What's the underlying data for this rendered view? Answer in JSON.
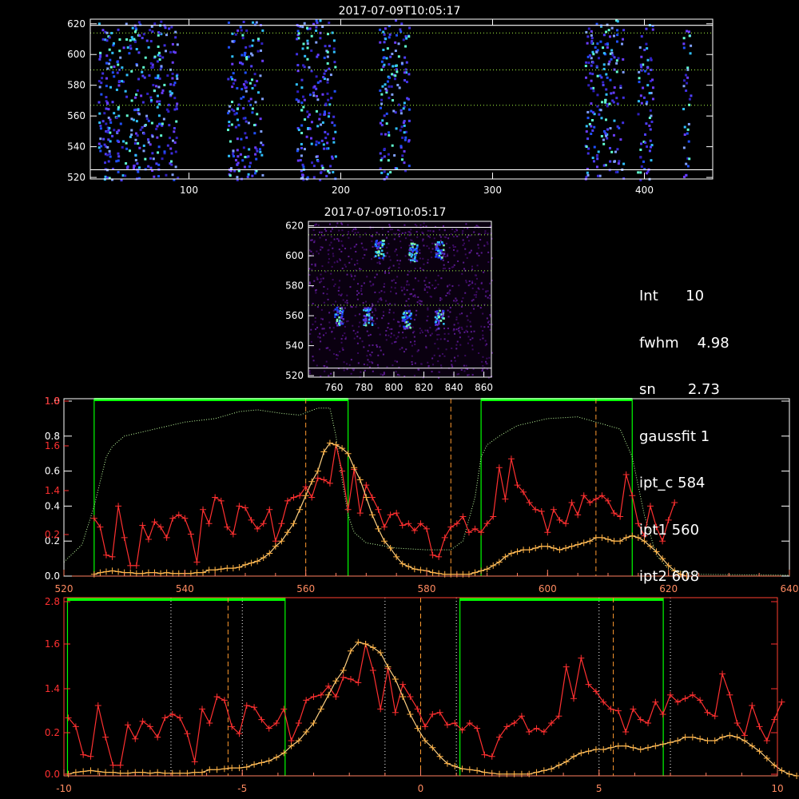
{
  "titles": {
    "top": "2017-07-09T10:05:17",
    "middle": "2017-07-09T10:05:17"
  },
  "info": [
    {
      "label": "Int",
      "value": "10"
    },
    {
      "label": "fwhm",
      "value": "4.98"
    },
    {
      "label": "sn",
      "value": "2.73"
    },
    {
      "label": "gaussfit",
      "value": "1"
    },
    {
      "label": "ipt_c",
      "value": "584"
    },
    {
      "label": "ipt1",
      "value": "560"
    },
    {
      "label": "ipt2",
      "value": "608"
    }
  ],
  "colors": {
    "red": "#ff3030",
    "orange": "#ffb040",
    "green": "#00ff00",
    "dash": "#ff9a30",
    "white": "#ffffff"
  },
  "chart_data": [
    {
      "type": "heatmap",
      "title": "2017-07-09T10:05:17",
      "xlim": [
        35,
        445
      ],
      "ylim": [
        519,
        623
      ],
      "xticks": [
        100,
        200,
        300,
        400
      ],
      "yticks": [
        520,
        540,
        560,
        580,
        600,
        620
      ],
      "column_bands": [
        [
          40,
          92
        ],
        [
          125,
          148
        ],
        [
          170,
          196
        ],
        [
          225,
          245
        ],
        [
          360,
          386
        ],
        [
          395,
          405
        ],
        [
          425,
          430
        ]
      ],
      "hlines_solid": [
        525,
        619
      ],
      "hlines_dotted": [
        567,
        590,
        614
      ]
    },
    {
      "type": "heatmap",
      "title": "2017-07-09T10:05:17",
      "xlim": [
        743,
        865
      ],
      "ylim": [
        519,
        623
      ],
      "xticks": [
        760,
        780,
        800,
        820,
        840,
        860
      ],
      "yticks": [
        520,
        540,
        560,
        580,
        600,
        620
      ],
      "blobs": [
        [
          763,
          560
        ],
        [
          782,
          560
        ],
        [
          808,
          558
        ],
        [
          830,
          558
        ],
        [
          830,
          604
        ],
        [
          790,
          605
        ],
        [
          812,
          603
        ]
      ],
      "hlines_solid": [
        525,
        619
      ],
      "hlines_dotted": [
        567,
        590,
        614
      ]
    },
    {
      "type": "line",
      "xlim": [
        520,
        640
      ],
      "xticks": [
        520,
        540,
        560,
        580,
        600,
        620,
        640
      ],
      "left_axis_white": {
        "ylim": [
          0,
          1.0
        ],
        "ticks": [
          "0.0",
          "0.2",
          "0.4",
          "0.6",
          "0.8",
          "1.0"
        ]
      },
      "left_axis_red": {
        "ticks": [
          "0.2",
          "1.4",
          "1.6",
          "1.8"
        ]
      },
      "red_x_start": 525,
      "red_x_step": 1,
      "red_values": [
        0.33,
        0.28,
        0.12,
        0.11,
        0.4,
        0.22,
        0.06,
        0.06,
        0.29,
        0.21,
        0.31,
        0.28,
        0.22,
        0.33,
        0.35,
        0.33,
        0.24,
        0.08,
        0.38,
        0.3,
        0.45,
        0.43,
        0.28,
        0.24,
        0.4,
        0.39,
        0.32,
        0.27,
        0.3,
        0.38,
        0.2,
        0.3,
        0.43,
        0.45,
        0.46,
        0.51,
        0.45,
        0.56,
        0.55,
        0.53,
        0.75,
        0.6,
        0.38,
        0.61,
        0.36,
        0.52,
        0.45,
        0.38,
        0.28,
        0.35,
        0.36,
        0.29,
        0.3,
        0.26,
        0.3,
        0.27,
        0.12,
        0.11,
        0.22,
        0.28,
        0.3,
        0.34,
        0.25,
        0.27,
        0.25,
        0.3,
        0.34,
        0.62,
        0.44,
        0.67,
        0.52,
        0.48,
        0.42,
        0.38,
        0.37,
        0.25,
        0.38,
        0.32,
        0.3,
        0.42,
        0.35,
        0.46,
        0.42,
        0.44,
        0.46,
        0.43,
        0.36,
        0.34,
        0.58,
        0.46,
        0.3,
        0.23,
        0.4,
        0.28,
        0.2,
        0.32,
        0.42
      ],
      "orange_x_start": 525,
      "orange_x_step": 1,
      "orange_values": [
        0.01,
        0.02,
        0.025,
        0.03,
        0.025,
        0.02,
        0.02,
        0.015,
        0.015,
        0.02,
        0.02,
        0.015,
        0.02,
        0.015,
        0.015,
        0.015,
        0.015,
        0.02,
        0.02,
        0.035,
        0.035,
        0.04,
        0.045,
        0.045,
        0.05,
        0.065,
        0.075,
        0.085,
        0.105,
        0.13,
        0.17,
        0.2,
        0.25,
        0.3,
        0.38,
        0.46,
        0.54,
        0.6,
        0.71,
        0.76,
        0.75,
        0.73,
        0.7,
        0.62,
        0.55,
        0.45,
        0.35,
        0.27,
        0.2,
        0.16,
        0.11,
        0.07,
        0.055,
        0.04,
        0.035,
        0.03,
        0.02,
        0.015,
        0.01,
        0.01,
        0.01,
        0.01,
        0.01,
        0.02,
        0.03,
        0.04,
        0.06,
        0.08,
        0.11,
        0.13,
        0.14,
        0.15,
        0.15,
        0.16,
        0.17,
        0.17,
        0.16,
        0.15,
        0.16,
        0.17,
        0.18,
        0.19,
        0.2,
        0.22,
        0.22,
        0.21,
        0.2,
        0.2,
        0.22,
        0.23,
        0.22,
        0.2,
        0.17,
        0.14,
        0.1,
        0.06,
        0.03,
        0.01,
        0.0
      ],
      "green_dotted_profile": [
        [
          520,
          0.08
        ],
        [
          523,
          0.18
        ],
        [
          525,
          0.4
        ],
        [
          527,
          0.68
        ],
        [
          528,
          0.74
        ],
        [
          530,
          0.8
        ],
        [
          535,
          0.84
        ],
        [
          540,
          0.88
        ],
        [
          545,
          0.9
        ],
        [
          549,
          0.94
        ],
        [
          552,
          0.95
        ],
        [
          556,
          0.93
        ],
        [
          559,
          0.92
        ],
        [
          562,
          0.96
        ],
        [
          564,
          0.96
        ],
        [
          565,
          0.8
        ],
        [
          566,
          0.55
        ],
        [
          567,
          0.35
        ],
        [
          568,
          0.25
        ],
        [
          570,
          0.19
        ],
        [
          575,
          0.16
        ],
        [
          580,
          0.15
        ],
        [
          584,
          0.15
        ],
        [
          586,
          0.2
        ],
        [
          588,
          0.45
        ],
        [
          589,
          0.68
        ],
        [
          590,
          0.75
        ],
        [
          592,
          0.8
        ],
        [
          595,
          0.86
        ],
        [
          600,
          0.9
        ],
        [
          605,
          0.91
        ],
        [
          608,
          0.88
        ],
        [
          612,
          0.84
        ],
        [
          614,
          0.68
        ],
        [
          616,
          0.35
        ],
        [
          618,
          0.12
        ],
        [
          620,
          0.04
        ],
        [
          625,
          0.01
        ],
        [
          640,
          0.005
        ]
      ],
      "green_windows": [
        [
          525,
          567
        ],
        [
          589,
          614
        ]
      ],
      "vlines_dashed": [
        560,
        584,
        608
      ]
    },
    {
      "type": "line",
      "xlim": [
        -10,
        10
      ],
      "xticks": [
        -10,
        -5,
        0,
        5,
        10
      ],
      "left_axis_red": {
        "ticks": [
          "0.0",
          "0.2",
          "1.4",
          "1.6",
          "2.8"
        ]
      },
      "red_x_start": -9.875,
      "red_x_step": 0.2083,
      "red_values": [
        0.33,
        0.28,
        0.12,
        0.11,
        0.4,
        0.22,
        0.06,
        0.06,
        0.29,
        0.21,
        0.31,
        0.28,
        0.22,
        0.33,
        0.35,
        0.33,
        0.24,
        0.08,
        0.38,
        0.3,
        0.45,
        0.43,
        0.28,
        0.24,
        0.4,
        0.39,
        0.32,
        0.27,
        0.3,
        0.38,
        0.2,
        0.3,
        0.43,
        0.45,
        0.46,
        0.51,
        0.45,
        0.56,
        0.55,
        0.53,
        0.75,
        0.6,
        0.38,
        0.61,
        0.36,
        0.52,
        0.45,
        0.38,
        0.28,
        0.35,
        0.36,
        0.29,
        0.3,
        0.26,
        0.3,
        0.27,
        0.12,
        0.11,
        0.22,
        0.28,
        0.3,
        0.34,
        0.25,
        0.27,
        0.25,
        0.3,
        0.34,
        0.62,
        0.44,
        0.67,
        0.52,
        0.48,
        0.42,
        0.38,
        0.37,
        0.25,
        0.38,
        0.32,
        0.3,
        0.42,
        0.35,
        0.46,
        0.42,
        0.44,
        0.46,
        0.43,
        0.36,
        0.34,
        0.58,
        0.46,
        0.3,
        0.23,
        0.4,
        0.28,
        0.2,
        0.32,
        0.42
      ],
      "orange_x_start": -9.875,
      "orange_x_step": 0.2083,
      "orange_values": [
        0.01,
        0.02,
        0.025,
        0.03,
        0.025,
        0.02,
        0.02,
        0.015,
        0.015,
        0.02,
        0.02,
        0.015,
        0.02,
        0.015,
        0.015,
        0.015,
        0.015,
        0.02,
        0.02,
        0.035,
        0.035,
        0.04,
        0.045,
        0.045,
        0.05,
        0.065,
        0.075,
        0.085,
        0.105,
        0.13,
        0.17,
        0.2,
        0.25,
        0.3,
        0.38,
        0.46,
        0.54,
        0.6,
        0.71,
        0.76,
        0.75,
        0.73,
        0.7,
        0.62,
        0.55,
        0.45,
        0.35,
        0.27,
        0.2,
        0.16,
        0.11,
        0.07,
        0.055,
        0.04,
        0.035,
        0.03,
        0.02,
        0.015,
        0.01,
        0.01,
        0.01,
        0.01,
        0.01,
        0.02,
        0.03,
        0.04,
        0.06,
        0.08,
        0.11,
        0.13,
        0.14,
        0.15,
        0.15,
        0.16,
        0.17,
        0.17,
        0.16,
        0.15,
        0.16,
        0.17,
        0.18,
        0.19,
        0.2,
        0.22,
        0.22,
        0.21,
        0.2,
        0.2,
        0.22,
        0.23,
        0.22,
        0.2,
        0.17,
        0.14,
        0.1,
        0.06,
        0.03,
        0.01,
        0.0
      ],
      "green_windows": [
        [
          -9.9,
          -3.8
        ],
        [
          1.1,
          6.8
        ]
      ],
      "vlines_dashed": [
        -5.4,
        0.0,
        5.4
      ],
      "vlines_dotted": [
        -7.0,
        -5.0,
        -1.0,
        1.0,
        5.0,
        7.0
      ]
    }
  ]
}
